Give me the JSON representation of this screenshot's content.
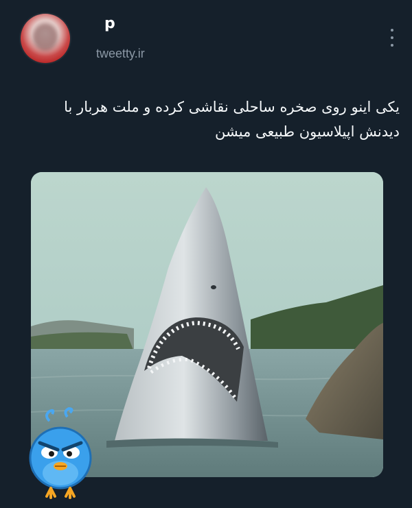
{
  "user": {
    "display_name": "p",
    "handle": "tweetty.ir"
  },
  "tweet": {
    "text_line1": "یکی اینو روی صخره ساحلی نقاشی کرده و ملت هربار با",
    "text_line2": "دیدنش اپیلاسیون طبیعی میشن"
  },
  "icons": {
    "more": "more-vertical-icon",
    "sticker": "angry-blue-bird-sticker"
  },
  "colors": {
    "background": "#15202b",
    "text": "#e7e9ea",
    "secondary": "#8b98a5"
  }
}
